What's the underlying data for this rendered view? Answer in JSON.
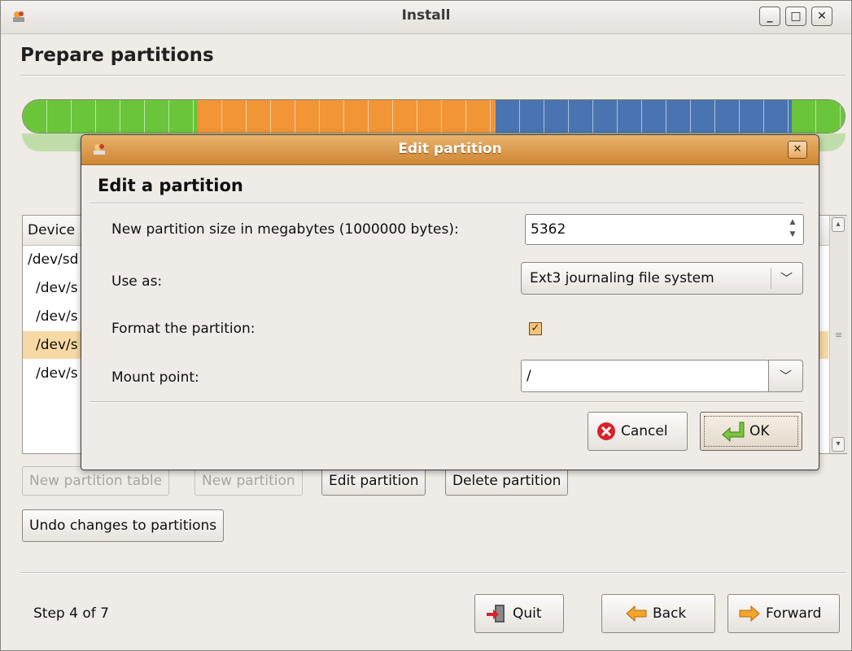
{
  "window": {
    "title": "Install"
  },
  "page": {
    "title": "Prepare partitions"
  },
  "partition_bar": {
    "segments": [
      {
        "color": "#6ac53a",
        "fraction": 0.213
      },
      {
        "color": "#f19537",
        "fraction": 0.362
      },
      {
        "color": "#4a74b1",
        "fraction": 0.361
      },
      {
        "color": "#6ac53a",
        "fraction": 0.064
      }
    ]
  },
  "partition_list": {
    "header_device": "Device",
    "rows": [
      {
        "device": "/dev/sd",
        "indent": false,
        "selected": false
      },
      {
        "device": "/dev/s",
        "indent": true,
        "selected": false
      },
      {
        "device": "/dev/s",
        "indent": true,
        "selected": false
      },
      {
        "device": "/dev/s",
        "indent": true,
        "selected": true
      },
      {
        "device": "/dev/s",
        "indent": true,
        "selected": false
      }
    ]
  },
  "partition_buttons": {
    "new_table": "New partition table",
    "new_partition": "New partition",
    "edit_partition": "Edit partition",
    "delete_partition": "Delete partition",
    "undo": "Undo changes to partitions"
  },
  "footer": {
    "step": "Step 4 of 7",
    "quit": "Quit",
    "back": "Back",
    "forward": "Forward"
  },
  "dialog": {
    "title": "Edit partition",
    "heading": "Edit a partition",
    "size_label": "New partition size in megabytes (1000000 bytes):",
    "size_value": "5362",
    "use_as_label": "Use as:",
    "use_as_value": "Ext3 journaling file system",
    "format_label": "Format the partition:",
    "format_checked": true,
    "mount_label": "Mount point:",
    "mount_value": "/",
    "cancel": "Cancel",
    "ok": "OK"
  },
  "colors": {
    "selection": "#f7d9a5",
    "dialog_title": "#cf8634"
  }
}
